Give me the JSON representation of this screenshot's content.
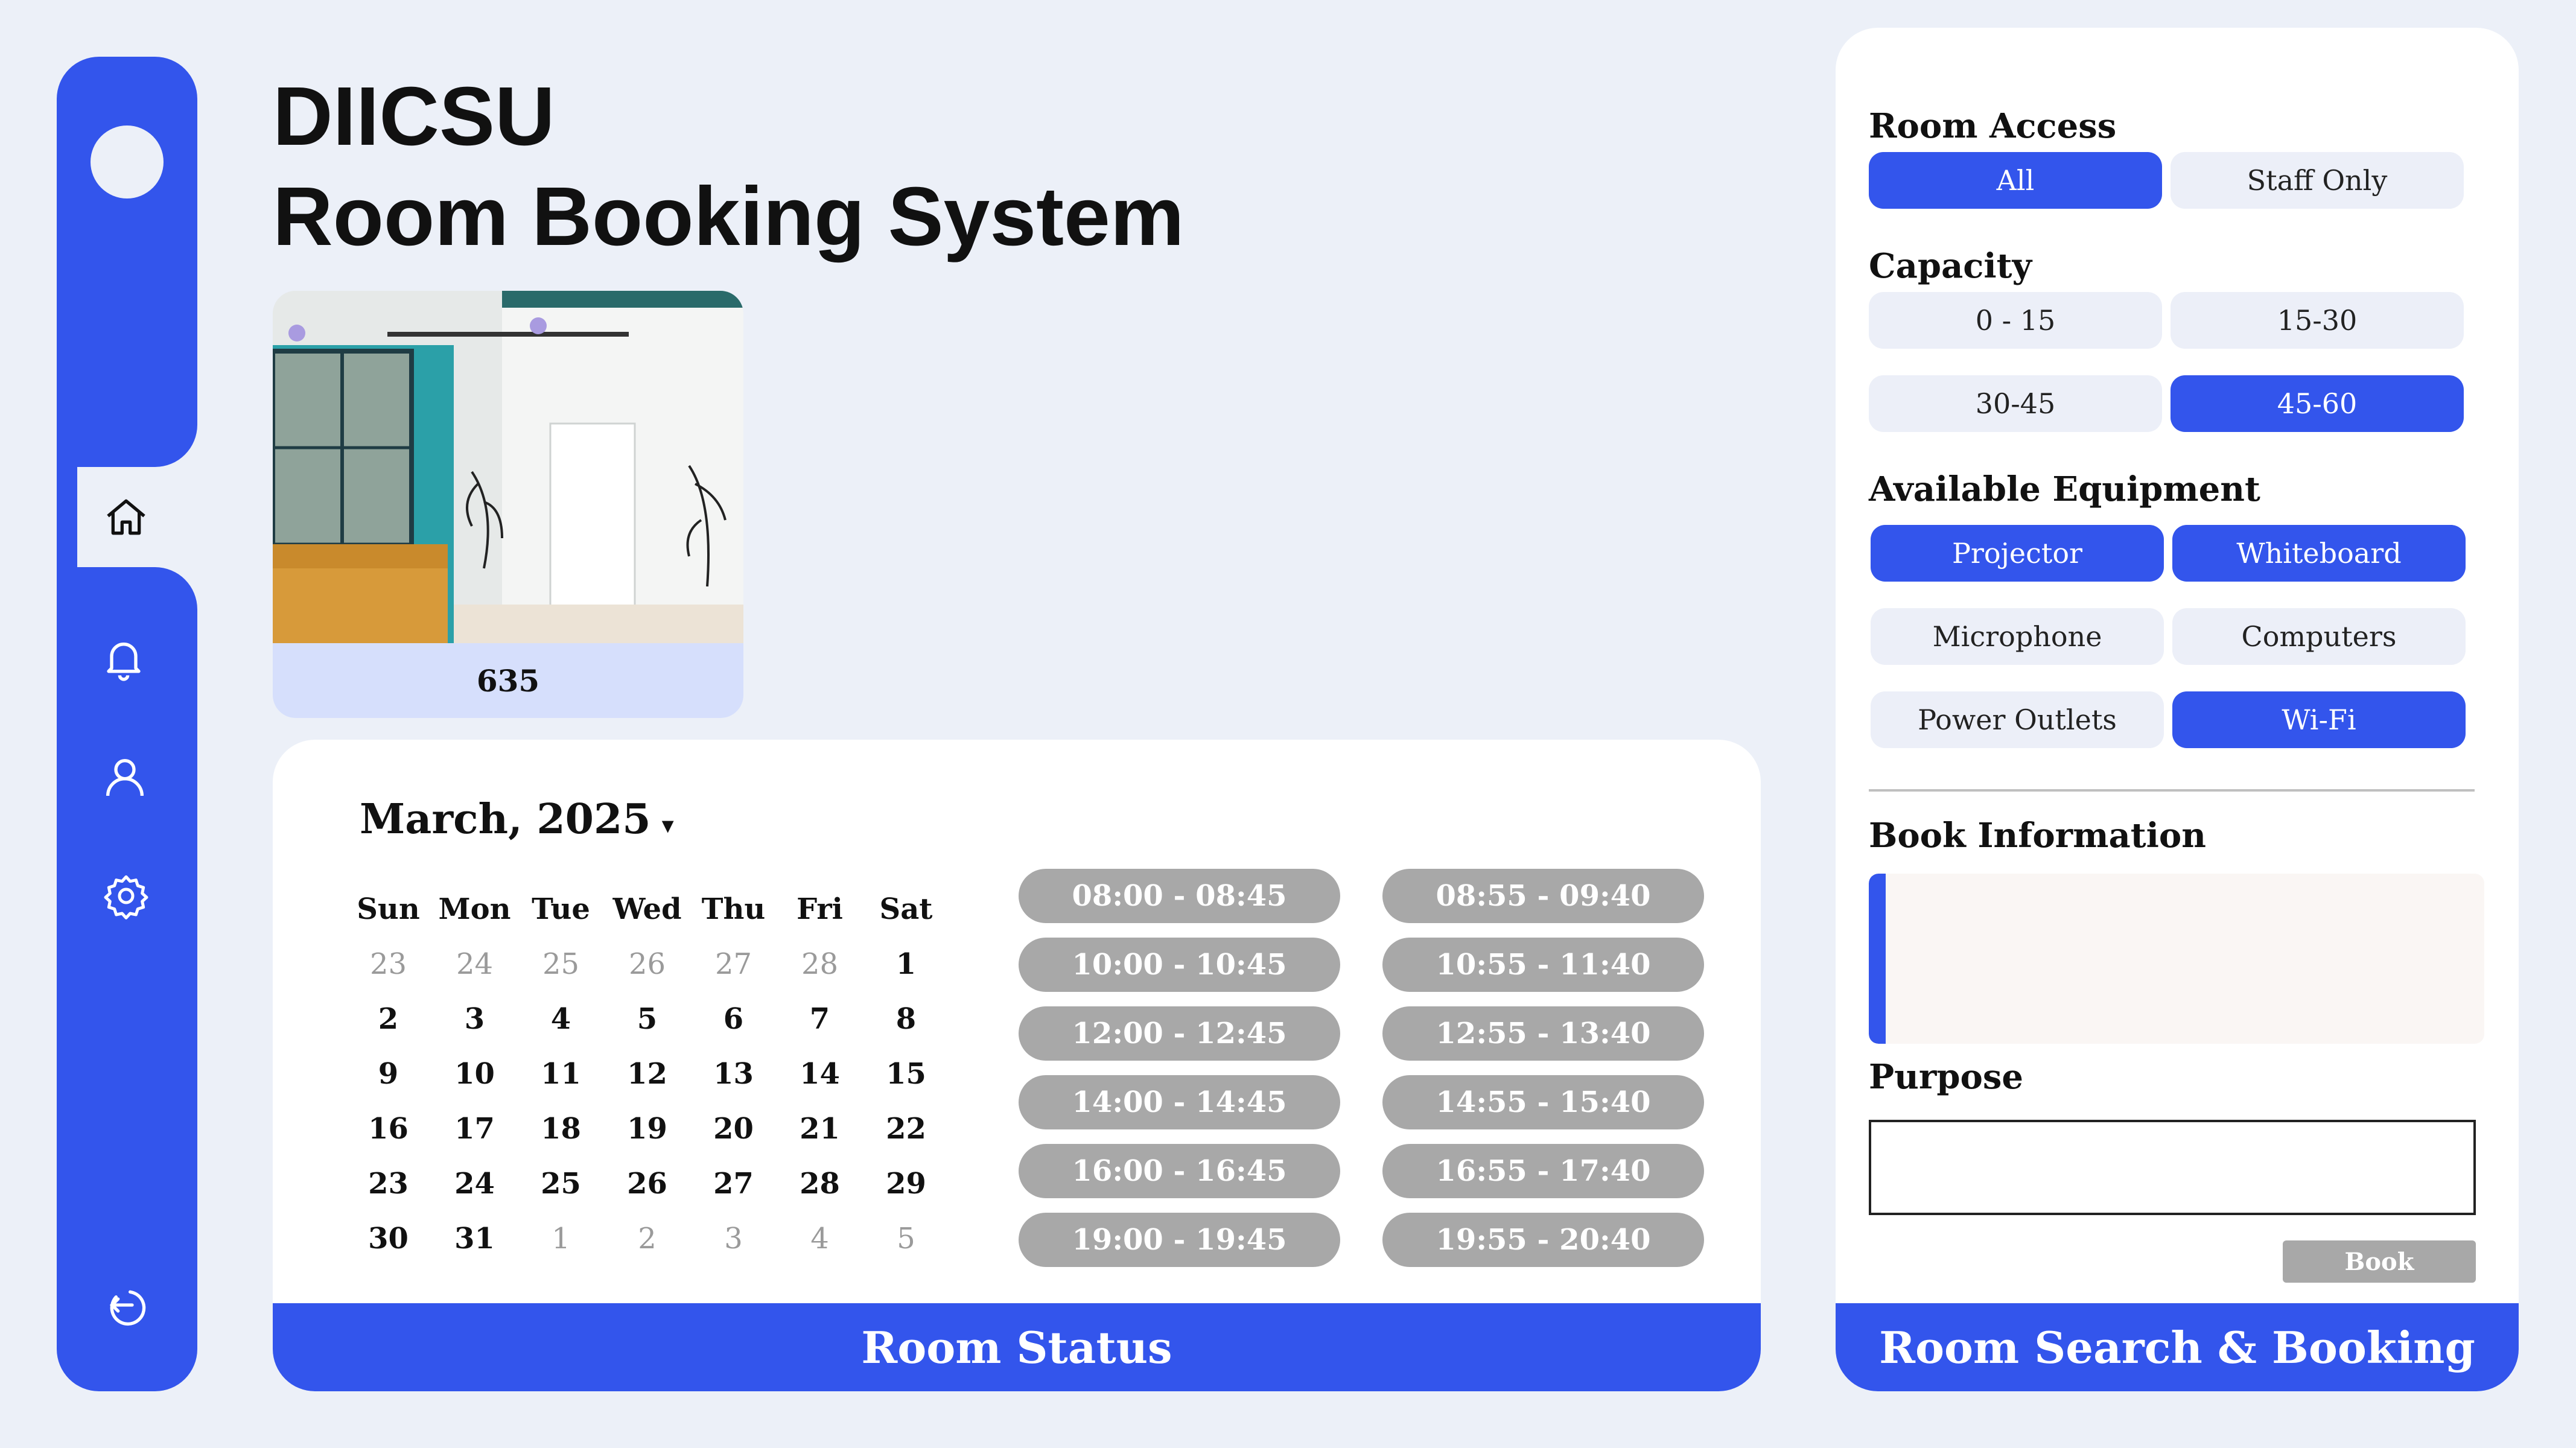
{
  "app": {
    "title_line1": "DIICSU",
    "title_line2": "Room Booking System"
  },
  "sidebar": {
    "icons": [
      "avatar-circle",
      "home-icon",
      "bell-icon",
      "user-icon",
      "gear-icon",
      "logout-icon"
    ],
    "active": "home",
    "accent": "#3355ec"
  },
  "room": {
    "number": "635"
  },
  "status": {
    "month": "March, 2025",
    "caret": "▾",
    "weekdays": [
      "Sun",
      "Mon",
      "Tue",
      "Wed",
      "Thu",
      "Fri",
      "Sat"
    ],
    "weeks": [
      [
        {
          "d": "23",
          "m": true
        },
        {
          "d": "24",
          "m": true
        },
        {
          "d": "25",
          "m": true
        },
        {
          "d": "26",
          "m": true
        },
        {
          "d": "27",
          "m": true
        },
        {
          "d": "28",
          "m": true
        },
        {
          "d": "1",
          "m": false
        }
      ],
      [
        {
          "d": "2",
          "m": false
        },
        {
          "d": "3",
          "m": false
        },
        {
          "d": "4",
          "m": false
        },
        {
          "d": "5",
          "m": false
        },
        {
          "d": "6",
          "m": false
        },
        {
          "d": "7",
          "m": false
        },
        {
          "d": "8",
          "m": false
        }
      ],
      [
        {
          "d": "9",
          "m": false
        },
        {
          "d": "10",
          "m": false
        },
        {
          "d": "11",
          "m": false
        },
        {
          "d": "12",
          "m": false
        },
        {
          "d": "13",
          "m": false
        },
        {
          "d": "14",
          "m": false
        },
        {
          "d": "15",
          "m": false
        }
      ],
      [
        {
          "d": "16",
          "m": false
        },
        {
          "d": "17",
          "m": false
        },
        {
          "d": "18",
          "m": false
        },
        {
          "d": "19",
          "m": false
        },
        {
          "d": "20",
          "m": false
        },
        {
          "d": "21",
          "m": false
        },
        {
          "d": "22",
          "m": false
        }
      ],
      [
        {
          "d": "23",
          "m": false
        },
        {
          "d": "24",
          "m": false
        },
        {
          "d": "25",
          "m": false
        },
        {
          "d": "26",
          "m": false
        },
        {
          "d": "27",
          "m": false
        },
        {
          "d": "28",
          "m": false
        },
        {
          "d": "29",
          "m": false
        }
      ],
      [
        {
          "d": "30",
          "m": false
        },
        {
          "d": "31",
          "m": false
        },
        {
          "d": "1",
          "m": true
        },
        {
          "d": "2",
          "m": true
        },
        {
          "d": "3",
          "m": true
        },
        {
          "d": "4",
          "m": true
        },
        {
          "d": "5",
          "m": true
        }
      ]
    ],
    "slots": [
      "08:00 - 08:45",
      "08:55 - 09:40",
      "10:00 - 10:45",
      "10:55 - 11:40",
      "12:00 - 12:45",
      "12:55 - 13:40",
      "14:00 - 14:45",
      "14:55 - 15:40",
      "16:00 - 16:45",
      "16:55 - 17:40",
      "19:00 - 19:45",
      "19:55 - 20:40"
    ],
    "footer": "Room Status"
  },
  "search": {
    "access_label": "Room Access",
    "access_options": [
      {
        "label": "All",
        "on": true
      },
      {
        "label": "Staff Only",
        "on": false
      }
    ],
    "capacity_label": "Capacity",
    "capacity_options": [
      {
        "label": "0 - 15",
        "on": false
      },
      {
        "label": "15-30",
        "on": false
      },
      {
        "label": "30-45",
        "on": false
      },
      {
        "label": "45-60",
        "on": true
      }
    ],
    "equipment_label": "Available Equipment",
    "equipment_options": [
      {
        "label": "Projector",
        "on": true
      },
      {
        "label": "Whiteboard",
        "on": true
      },
      {
        "label": "Microphone",
        "on": false
      },
      {
        "label": "Computers",
        "on": false
      },
      {
        "label": "Power Outlets",
        "on": false
      },
      {
        "label": "Wi-Fi",
        "on": true
      }
    ],
    "book_info_label": "Book Information",
    "purpose_label": "Purpose",
    "purpose_value": "",
    "book_button": "Book",
    "footer": "Room Search & Booking"
  }
}
